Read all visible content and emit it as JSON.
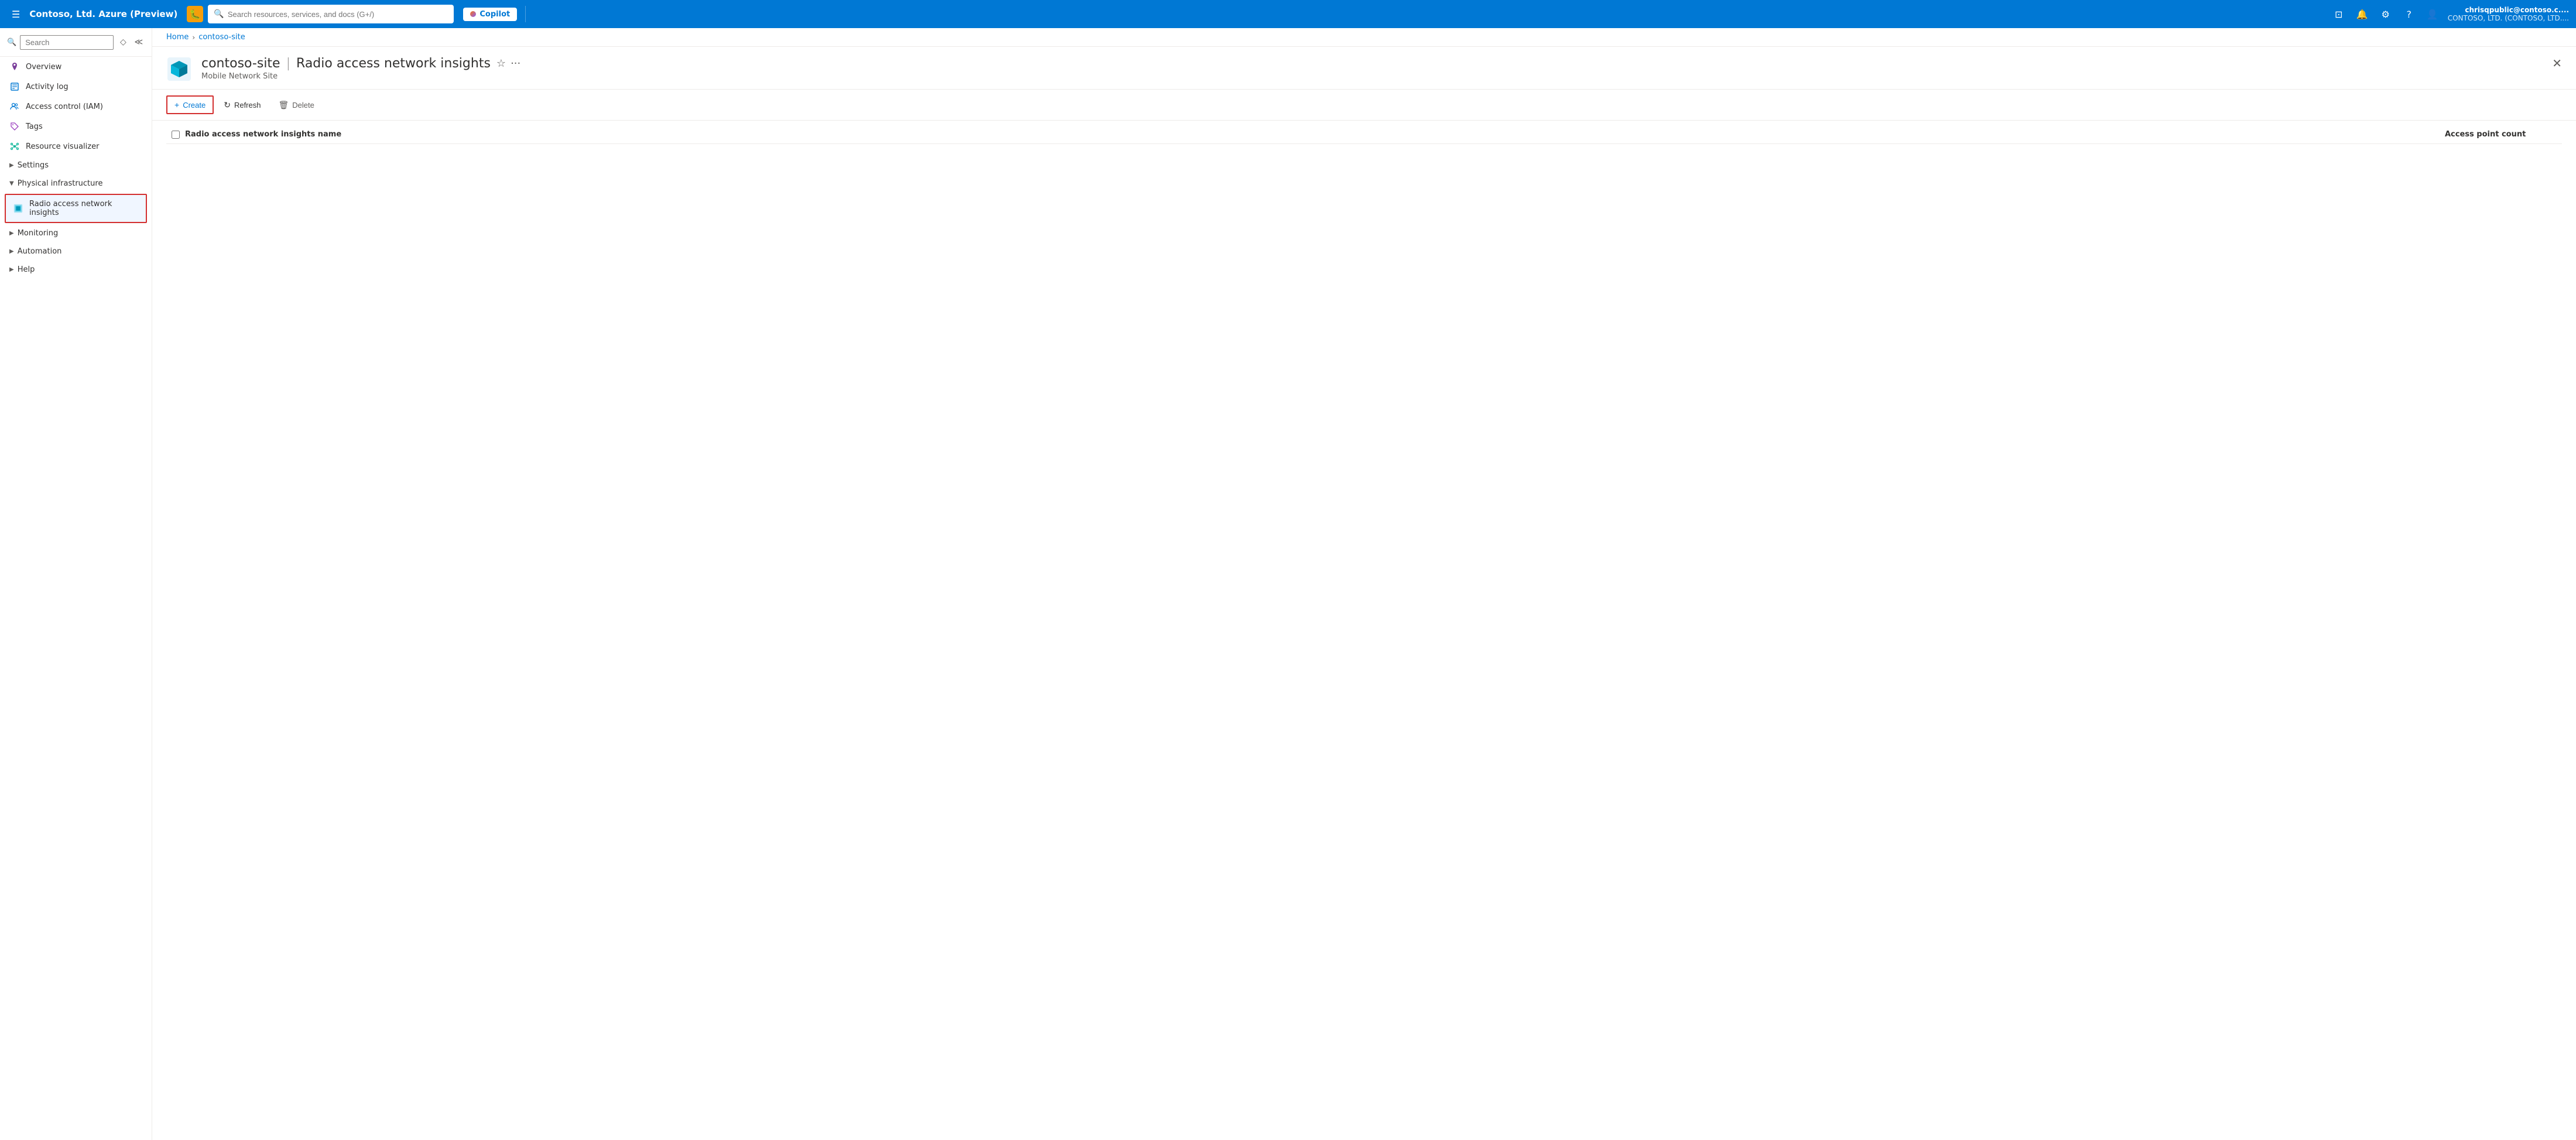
{
  "topNav": {
    "logoText": "Contoso, Ltd. Azure (Preview)",
    "searchPlaceholder": "Search resources, services, and docs (G+/)",
    "copilotLabel": "Copilot",
    "userName": "chrisqpublic@contoso.c....",
    "userOrg": "CONTOSO, LTD. (CONTOSO, LTD....",
    "icons": [
      "portal-icon",
      "bell-icon",
      "settings-icon",
      "help-icon",
      "feedback-icon"
    ]
  },
  "breadcrumb": {
    "home": "Home",
    "current": "contoso-site"
  },
  "pageHeader": {
    "title": "contoso-site",
    "separator": "|",
    "subtitle": "Radio access network insights",
    "resourceType": "Mobile Network Site",
    "closeTitle": "Close"
  },
  "toolbar": {
    "createLabel": "Create",
    "refreshLabel": "Refresh",
    "deleteLabel": "Delete"
  },
  "table": {
    "columns": {
      "name": "Radio access network insights name",
      "count": "Access point count"
    },
    "rows": []
  },
  "sidebar": {
    "searchPlaceholder": "Search",
    "items": [
      {
        "id": "overview",
        "label": "Overview",
        "icon": "location-icon"
      },
      {
        "id": "activity-log",
        "label": "Activity log",
        "icon": "log-icon"
      },
      {
        "id": "access-control",
        "label": "Access control (IAM)",
        "icon": "people-icon"
      },
      {
        "id": "tags",
        "label": "Tags",
        "icon": "tag-icon"
      },
      {
        "id": "resource-visualizer",
        "label": "Resource visualizer",
        "icon": "visualizer-icon"
      }
    ],
    "groups": [
      {
        "id": "settings",
        "label": "Settings",
        "expanded": false,
        "items": []
      },
      {
        "id": "physical-infrastructure",
        "label": "Physical infrastructure",
        "expanded": true,
        "items": [
          {
            "id": "radio-access-network-insights",
            "label": "Radio access network insights",
            "active": true
          }
        ]
      },
      {
        "id": "monitoring",
        "label": "Monitoring",
        "expanded": false,
        "items": []
      },
      {
        "id": "automation",
        "label": "Automation",
        "expanded": false,
        "items": []
      },
      {
        "id": "help",
        "label": "Help",
        "expanded": false,
        "items": []
      }
    ]
  }
}
